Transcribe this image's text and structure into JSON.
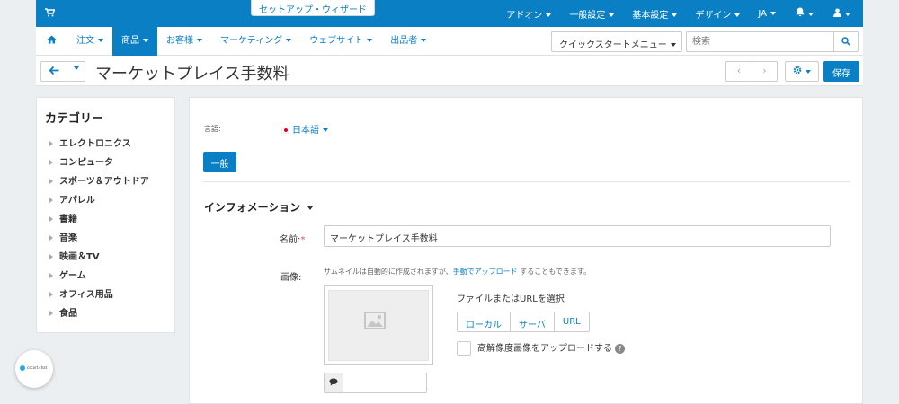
{
  "topbar": {
    "wizard": "セットアップ・ウィザード",
    "items": [
      "アドオン",
      "一般設定",
      "基本設定",
      "デザイン",
      "JA"
    ]
  },
  "mainnav": {
    "items": [
      "注文",
      "商品",
      "お客様",
      "マーケティング",
      "ウェブサイト",
      "出品者"
    ],
    "active": "商品",
    "quickstart": "クイックスタートメニュー",
    "search_placeholder": "検索"
  },
  "titlebar": {
    "title": "マーケットプレイス手数料",
    "save": "保存"
  },
  "sidebar": {
    "heading": "カテゴリー",
    "items": [
      "エレクトロニクス",
      "コンピュータ",
      "スポーツ＆アウトドア",
      "アパレル",
      "書籍",
      "音楽",
      "映画＆TV",
      "ゲーム",
      "オフィス用品",
      "食品"
    ]
  },
  "content": {
    "lang_label": "言語:",
    "lang_value": "日本語",
    "tab": "一般",
    "section": "インフォメーション",
    "name_label": "名前:",
    "name_required": "*",
    "name_value": "マーケットプレイス手数料",
    "image_label": "画像:",
    "hint_before": "サムネイルは自動的に作成されますが、",
    "hint_link": "手動でアップロード",
    "hint_after": " することもできます。",
    "choose_file": "ファイルまたはURLを選択",
    "sources": [
      "ローカル",
      "サーバ",
      "URL"
    ],
    "hires": "高解像度画像をアップロードする",
    "alt_value": ""
  },
  "bubble": {
    "label": "cscart.chat"
  },
  "colors": {
    "accent": "#0b7fc4",
    "background": "#eceff1"
  }
}
